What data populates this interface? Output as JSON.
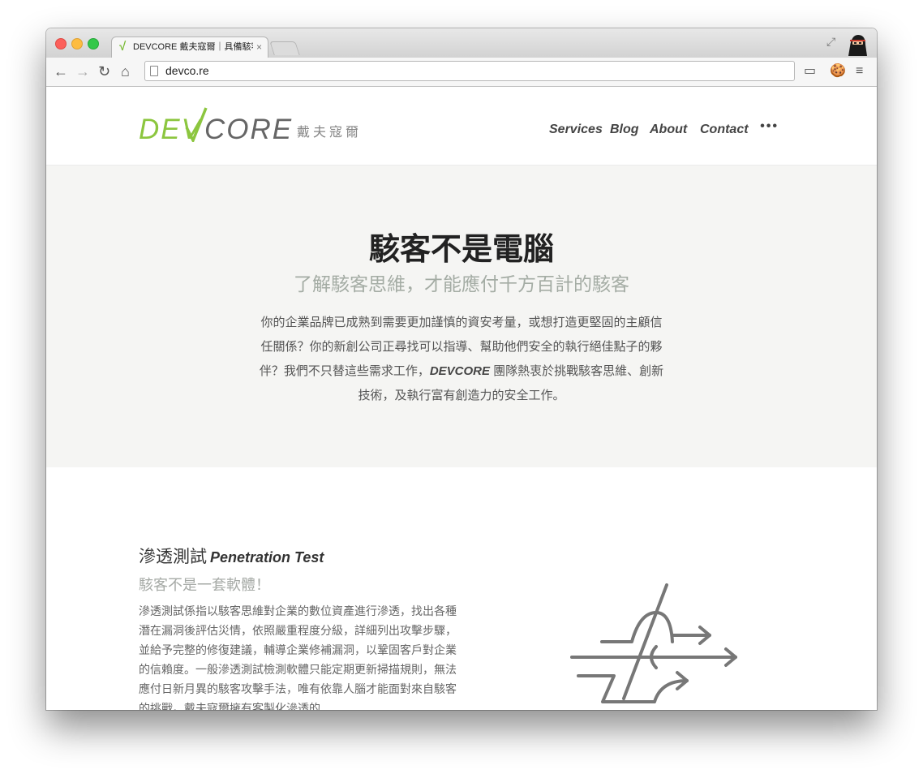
{
  "browser": {
    "tab": {
      "title": "DEVCORE 戴夫寇爾｜具備駭客",
      "close": "×",
      "favicon": "√"
    },
    "toolbar": {
      "back": "←",
      "forward": "→",
      "reload": "↻",
      "home": "⌂",
      "url": "devco.re",
      "cast": "▭",
      "cookie": "🍪",
      "menu": "≡"
    },
    "window_icons": {
      "fullscreen": "⤢"
    }
  },
  "site": {
    "logo": {
      "dev": "DEV",
      "core": "CORE",
      "cn": "戴夫寇爾"
    },
    "nav": {
      "services": "Services",
      "blog": "Blog",
      "about": "About",
      "contact": "Contact",
      "more": "•••"
    },
    "hero": {
      "title": "駭客不是電腦",
      "subtitle": "了解駭客思維，才能應付千方百計的駭客",
      "body_before": "你的企業品牌已成熟到需要更加謹慎的資安考量，或想打造更堅固的主顧信任關係？你的新創公司正尋找可以指導、幫助他們安全的執行絕佳點子的夥伴？我們不只替這些需求工作，",
      "body_brand": "DEVCORE",
      "body_after": " 團隊熱衷於挑戰駭客思維、創新技術，及執行富有創造力的安全工作。"
    },
    "pentest": {
      "title_cn": "滲透測試",
      "title_en": "Penetration Test",
      "subtitle": "駭客不是一套軟體！",
      "body": "滲透測試係指以駭客思維對企業的數位資產進行滲透，找出各種潛在漏洞後評估災情，依照嚴重程度分級，詳細列出攻擊步驟，並給予完整的修復建議，輔導企業修補漏洞，以鞏固客戶對企業的信賴度。一般滲透測試檢測軟體只能定期更新掃描規則，無法應付日新月異的駭客攻擊手法，唯有依靠人腦才能面對來自駭客的挑戰。戴夫寇爾擁有客製化滲透的"
    }
  },
  "colors": {
    "brand_green": "#8cc63f",
    "logo_gray": "#666666",
    "hero_bg": "#f5f5f3"
  }
}
